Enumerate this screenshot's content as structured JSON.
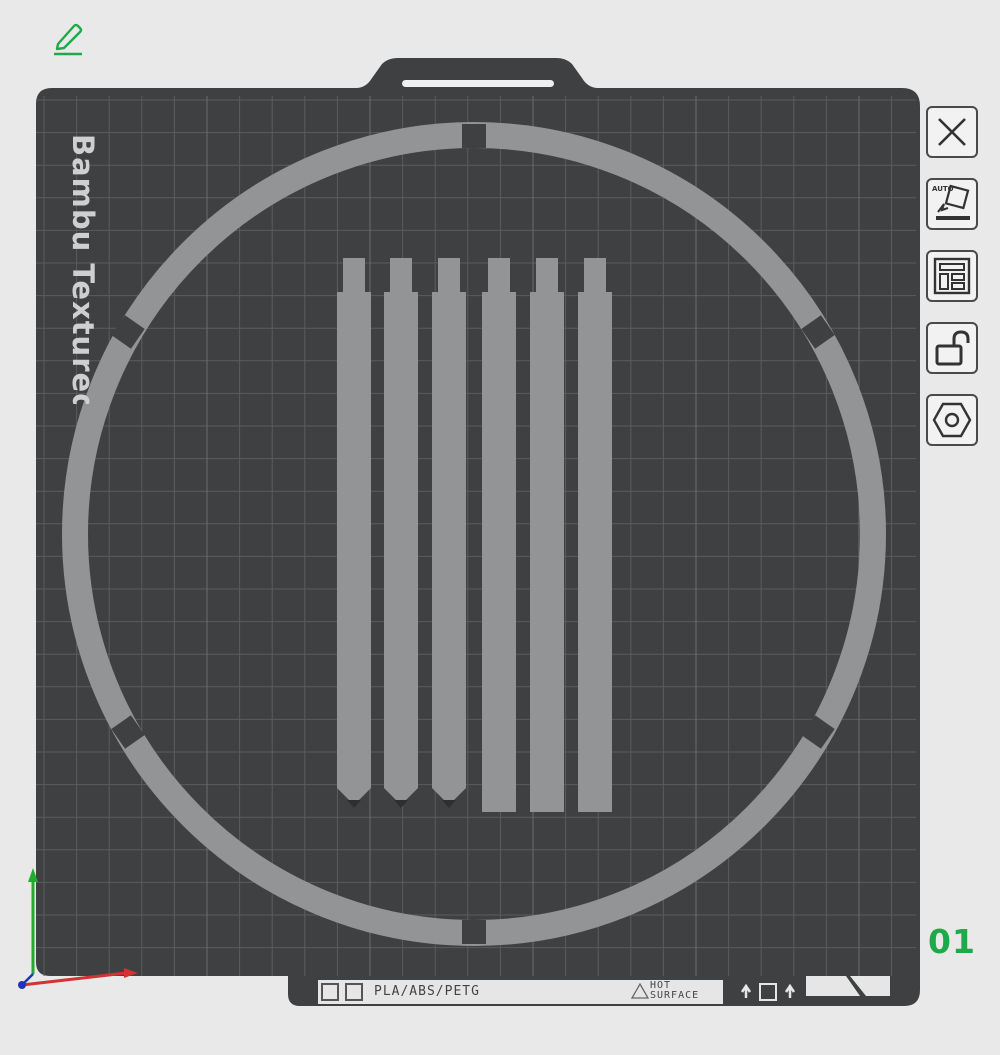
{
  "plate": {
    "brand_text": "Bambu Textured P",
    "material_label": "PLA/ABS/PETG",
    "hot_surface_label": "HOT\nSURFACE",
    "number": "01"
  },
  "toolbar": {
    "items": [
      {
        "name": "close-plate-button",
        "icon": "close-icon"
      },
      {
        "name": "auto-orient-button",
        "icon": "auto-orient-icon",
        "label": "AUTO"
      },
      {
        "name": "arrange-button",
        "icon": "arrange-icon"
      },
      {
        "name": "lock-button",
        "icon": "unlock-icon"
      },
      {
        "name": "plate-settings-button",
        "icon": "nut-settings-icon"
      }
    ]
  },
  "colors": {
    "accent": "#1faa4a",
    "bed": "#414243",
    "model": "#939495",
    "grid": "#5a5c5e",
    "x_axis": "#d23232",
    "y_axis": "#22aa33",
    "z_axis": "#2233bb"
  }
}
